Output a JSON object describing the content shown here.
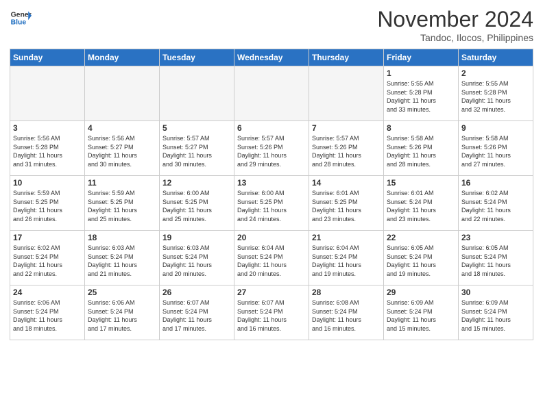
{
  "header": {
    "logo_general": "General",
    "logo_blue": "Blue",
    "month": "November 2024",
    "location": "Tandoc, Ilocos, Philippines"
  },
  "weekdays": [
    "Sunday",
    "Monday",
    "Tuesday",
    "Wednesday",
    "Thursday",
    "Friday",
    "Saturday"
  ],
  "weeks": [
    [
      {
        "day": "",
        "info": ""
      },
      {
        "day": "",
        "info": ""
      },
      {
        "day": "",
        "info": ""
      },
      {
        "day": "",
        "info": ""
      },
      {
        "day": "",
        "info": ""
      },
      {
        "day": "1",
        "info": "Sunrise: 5:55 AM\nSunset: 5:28 PM\nDaylight: 11 hours\nand 33 minutes."
      },
      {
        "day": "2",
        "info": "Sunrise: 5:55 AM\nSunset: 5:28 PM\nDaylight: 11 hours\nand 32 minutes."
      }
    ],
    [
      {
        "day": "3",
        "info": "Sunrise: 5:56 AM\nSunset: 5:28 PM\nDaylight: 11 hours\nand 31 minutes."
      },
      {
        "day": "4",
        "info": "Sunrise: 5:56 AM\nSunset: 5:27 PM\nDaylight: 11 hours\nand 30 minutes."
      },
      {
        "day": "5",
        "info": "Sunrise: 5:57 AM\nSunset: 5:27 PM\nDaylight: 11 hours\nand 30 minutes."
      },
      {
        "day": "6",
        "info": "Sunrise: 5:57 AM\nSunset: 5:26 PM\nDaylight: 11 hours\nand 29 minutes."
      },
      {
        "day": "7",
        "info": "Sunrise: 5:57 AM\nSunset: 5:26 PM\nDaylight: 11 hours\nand 28 minutes."
      },
      {
        "day": "8",
        "info": "Sunrise: 5:58 AM\nSunset: 5:26 PM\nDaylight: 11 hours\nand 28 minutes."
      },
      {
        "day": "9",
        "info": "Sunrise: 5:58 AM\nSunset: 5:26 PM\nDaylight: 11 hours\nand 27 minutes."
      }
    ],
    [
      {
        "day": "10",
        "info": "Sunrise: 5:59 AM\nSunset: 5:25 PM\nDaylight: 11 hours\nand 26 minutes."
      },
      {
        "day": "11",
        "info": "Sunrise: 5:59 AM\nSunset: 5:25 PM\nDaylight: 11 hours\nand 25 minutes."
      },
      {
        "day": "12",
        "info": "Sunrise: 6:00 AM\nSunset: 5:25 PM\nDaylight: 11 hours\nand 25 minutes."
      },
      {
        "day": "13",
        "info": "Sunrise: 6:00 AM\nSunset: 5:25 PM\nDaylight: 11 hours\nand 24 minutes."
      },
      {
        "day": "14",
        "info": "Sunrise: 6:01 AM\nSunset: 5:25 PM\nDaylight: 11 hours\nand 23 minutes."
      },
      {
        "day": "15",
        "info": "Sunrise: 6:01 AM\nSunset: 5:24 PM\nDaylight: 11 hours\nand 23 minutes."
      },
      {
        "day": "16",
        "info": "Sunrise: 6:02 AM\nSunset: 5:24 PM\nDaylight: 11 hours\nand 22 minutes."
      }
    ],
    [
      {
        "day": "17",
        "info": "Sunrise: 6:02 AM\nSunset: 5:24 PM\nDaylight: 11 hours\nand 22 minutes."
      },
      {
        "day": "18",
        "info": "Sunrise: 6:03 AM\nSunset: 5:24 PM\nDaylight: 11 hours\nand 21 minutes."
      },
      {
        "day": "19",
        "info": "Sunrise: 6:03 AM\nSunset: 5:24 PM\nDaylight: 11 hours\nand 20 minutes."
      },
      {
        "day": "20",
        "info": "Sunrise: 6:04 AM\nSunset: 5:24 PM\nDaylight: 11 hours\nand 20 minutes."
      },
      {
        "day": "21",
        "info": "Sunrise: 6:04 AM\nSunset: 5:24 PM\nDaylight: 11 hours\nand 19 minutes."
      },
      {
        "day": "22",
        "info": "Sunrise: 6:05 AM\nSunset: 5:24 PM\nDaylight: 11 hours\nand 19 minutes."
      },
      {
        "day": "23",
        "info": "Sunrise: 6:05 AM\nSunset: 5:24 PM\nDaylight: 11 hours\nand 18 minutes."
      }
    ],
    [
      {
        "day": "24",
        "info": "Sunrise: 6:06 AM\nSunset: 5:24 PM\nDaylight: 11 hours\nand 18 minutes."
      },
      {
        "day": "25",
        "info": "Sunrise: 6:06 AM\nSunset: 5:24 PM\nDaylight: 11 hours\nand 17 minutes."
      },
      {
        "day": "26",
        "info": "Sunrise: 6:07 AM\nSunset: 5:24 PM\nDaylight: 11 hours\nand 17 minutes."
      },
      {
        "day": "27",
        "info": "Sunrise: 6:07 AM\nSunset: 5:24 PM\nDaylight: 11 hours\nand 16 minutes."
      },
      {
        "day": "28",
        "info": "Sunrise: 6:08 AM\nSunset: 5:24 PM\nDaylight: 11 hours\nand 16 minutes."
      },
      {
        "day": "29",
        "info": "Sunrise: 6:09 AM\nSunset: 5:24 PM\nDaylight: 11 hours\nand 15 minutes."
      },
      {
        "day": "30",
        "info": "Sunrise: 6:09 AM\nSunset: 5:24 PM\nDaylight: 11 hours\nand 15 minutes."
      }
    ]
  ]
}
